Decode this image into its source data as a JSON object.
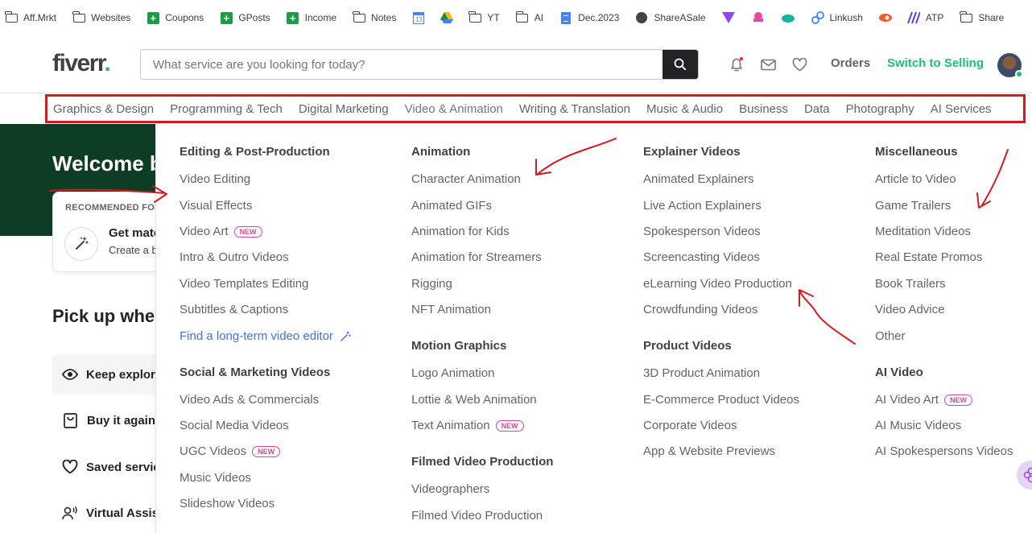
{
  "bookmarks": [
    {
      "label": "Aff.Mrkt",
      "icon": "folder-icon"
    },
    {
      "label": "Websites",
      "icon": "folder-icon"
    },
    {
      "label": "Coupons",
      "icon": "google-sheets-icon"
    },
    {
      "label": "GPosts",
      "icon": "google-sheets-icon"
    },
    {
      "label": "Income",
      "icon": "google-sheets-icon"
    },
    {
      "label": "Notes",
      "icon": "folder-icon"
    },
    {
      "label": "",
      "icon": "google-calendar-icon"
    },
    {
      "label": "",
      "icon": "google-drive-icon"
    },
    {
      "label": "YT",
      "icon": "folder-icon"
    },
    {
      "label": "AI",
      "icon": "folder-icon"
    },
    {
      "label": "Dec.2023",
      "icon": "google-docs-icon"
    },
    {
      "label": "ShareASale",
      "icon": "globe-icon"
    },
    {
      "label": "",
      "icon": "purple-app-icon"
    },
    {
      "label": "",
      "icon": "octopus-icon"
    },
    {
      "label": "",
      "icon": "whale-icon"
    },
    {
      "label": "Linkush",
      "icon": "link-icon"
    },
    {
      "label": "",
      "icon": "orange-app-icon"
    },
    {
      "label": "ATP",
      "icon": "atp-icon"
    },
    {
      "label": "Share",
      "icon": "folder-icon"
    }
  ],
  "header": {
    "logo": "fiverr",
    "logo_dot": ".",
    "search_placeholder": "What service are you looking for today?",
    "orders": "Orders",
    "switch": "Switch to Selling"
  },
  "categories": [
    "Graphics & Design",
    "Programming & Tech",
    "Digital Marketing",
    "Video & Animation",
    "Writing & Translation",
    "Music & Audio",
    "Business",
    "Data",
    "Photography",
    "AI Services"
  ],
  "page": {
    "hero": "Welcome back",
    "rec_label": "RECOMMENDED FOR YOU",
    "rec_title": "Get matched",
    "rec_sub": "Create a brief",
    "pickup": "Pick up where you left off",
    "side_items": [
      "Keep exploring",
      "Buy it again",
      "Saved services",
      "Virtual Assistant"
    ]
  },
  "dropdown": {
    "col1": {
      "g1": "Editing & Post-Production",
      "g1_items": [
        "Video Editing",
        "Visual Effects",
        "Video Art",
        "Intro & Outro Videos",
        "Video Templates Editing",
        "Subtitles & Captions"
      ],
      "g1_link": "Find a long-term video editor",
      "g2": "Social & Marketing Videos",
      "g2_items": [
        "Video Ads & Commercials",
        "Social Media Videos",
        "UGC Videos",
        "Music Videos",
        "Slideshow Videos"
      ]
    },
    "col2": {
      "g1": "Animation",
      "g1_items": [
        "Character Animation",
        "Animated GIFs",
        "Animation for Kids",
        "Animation for Streamers",
        "Rigging",
        "NFT Animation"
      ],
      "g2": "Motion Graphics",
      "g2_items": [
        "Logo Animation",
        "Lottie & Web Animation",
        "Text Animation"
      ],
      "g3": "Filmed Video Production",
      "g3_items": [
        "Videographers",
        "Filmed Video Production"
      ]
    },
    "col3": {
      "g1": "Explainer Videos",
      "g1_items": [
        "Animated Explainers",
        "Live Action Explainers",
        "Spokesperson Videos",
        "Screencasting Videos",
        "eLearning Video Production",
        "Crowdfunding Videos"
      ],
      "g2": "Product Videos",
      "g2_items": [
        "3D Product Animation",
        "E-Commerce Product Videos",
        "Corporate Videos",
        "App & Website Previews"
      ]
    },
    "col4": {
      "g1": "Miscellaneous",
      "g1_items": [
        "Article to Video",
        "Game Trailers",
        "Meditation Videos",
        "Real Estate Promos",
        "Book Trailers",
        "Video Advice",
        "Other"
      ],
      "g2": "AI Video",
      "g2_items": [
        "AI Video Art",
        "AI Music Videos",
        "AI Spokespersons Videos"
      ]
    },
    "badge": "NEW"
  },
  "colors": {
    "brand": "#1dbf73",
    "annotation": "#d71920",
    "badge": "#d24a96",
    "link": "#446ee7"
  }
}
